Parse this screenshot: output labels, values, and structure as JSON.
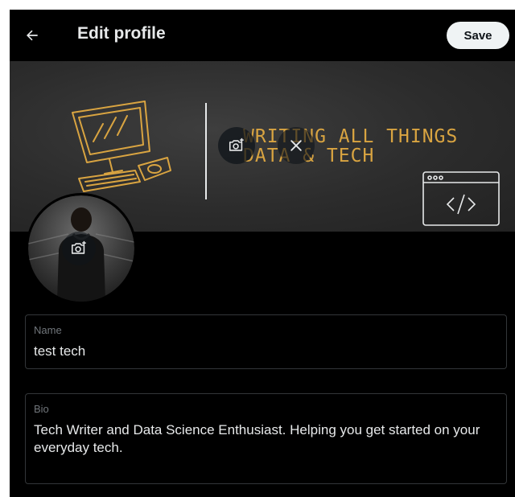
{
  "header": {
    "back_icon": "arrow-left-icon",
    "title": "Edit profile",
    "save_label": "Save"
  },
  "banner": {
    "text_line1": "WRITING ALL THINGS",
    "text_line2": "DATA & TECH",
    "camera_icon": "add-photo-icon",
    "remove_icon": "close-icon"
  },
  "avatar": {
    "camera_icon": "add-photo-icon"
  },
  "fields": {
    "name": {
      "label": "Name",
      "value": "test tech"
    },
    "bio": {
      "label": "Bio",
      "value": "Tech Writer and Data Science Enthusiast. Helping you get started on your everyday tech."
    }
  },
  "colors": {
    "background": "#000000",
    "text": "#e7e9ea",
    "muted": "#71767b",
    "border": "#333639",
    "accent_text": "#d9a441"
  }
}
